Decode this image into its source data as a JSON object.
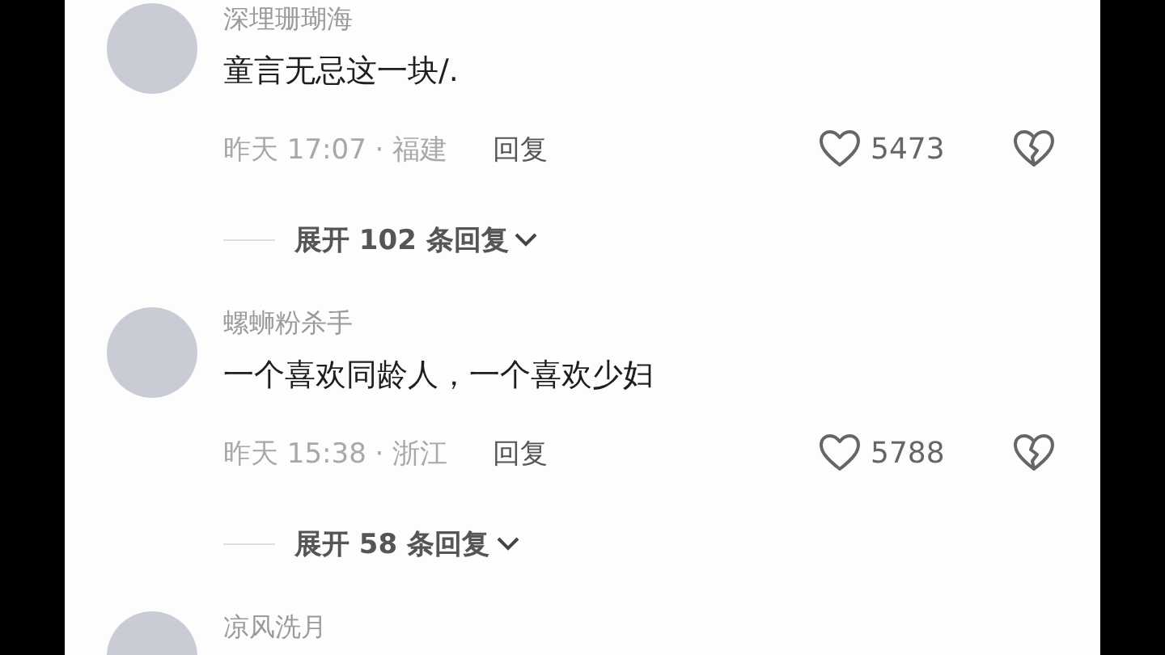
{
  "comments": [
    {
      "username": "深埋珊瑚海",
      "text": "童言无忌这一块/.",
      "meta": "昨天 17:07 · 福建",
      "reply": "回复",
      "likes": "5473",
      "expand": "展开 102 条回复"
    },
    {
      "username": "螺蛳粉杀手",
      "text": "一个喜欢同龄人，一个喜欢少妇",
      "meta": "昨天 15:38 · 浙江",
      "reply": "回复",
      "likes": "5788",
      "expand": "展开 58 条回复"
    },
    {
      "username": "凉风洗月"
    }
  ]
}
